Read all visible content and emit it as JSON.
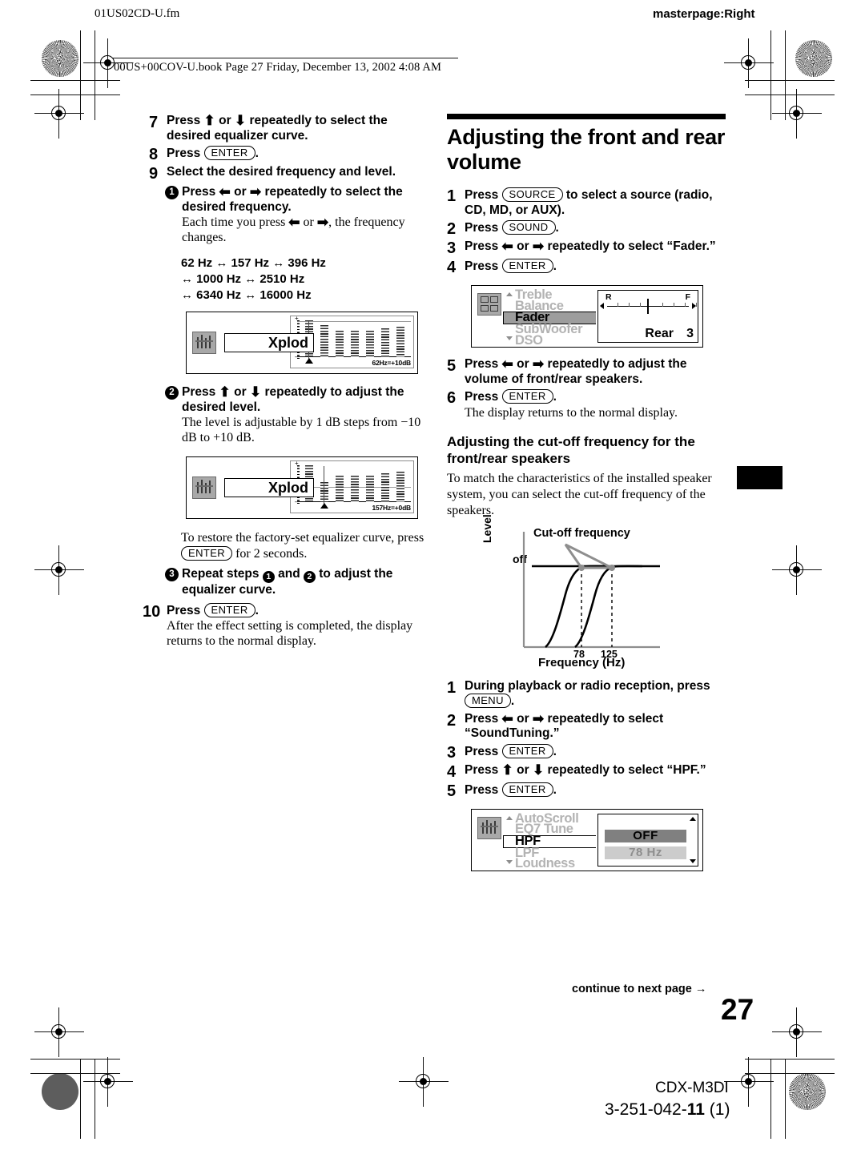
{
  "header": {
    "file_slug": "01US02CD-U.fm",
    "masterpage": "masterpage:Right",
    "book_slug": "00US+00COV-U.book  Page 27  Friday, December 13, 2002  4:08 AM"
  },
  "left_column": {
    "step7": {
      "num": "7",
      "text_a": "Press ",
      "arrow_up": "⬆",
      "text_or": " or ",
      "arrow_dn": "⬇",
      "text_b": " repeatedly to select the desired equalizer curve."
    },
    "step8": {
      "num": "8",
      "label": "Press ",
      "key": "ENTER",
      "period": "."
    },
    "step9": {
      "num": "9",
      "text": "Select the desired frequency and level."
    },
    "sub1": {
      "bullet": "1",
      "head_a": "Press ",
      "arrow_l": "⬅",
      "head_or": " or ",
      "arrow_r": "➡",
      "head_b": " repeatedly to select the desired frequency.",
      "note_a": "Each time you press ",
      "note_b": " or ",
      "note_c": ", the frequency changes.",
      "freq_line1": "62 Hz ↔ 157 Hz ↔ 396 Hz",
      "freq_line2": "↔ 1000 Hz ↔ 2510 Hz",
      "freq_line3": "↔ 6340 Hz ↔ 16000 Hz"
    },
    "lcd1": {
      "brand": "Xplod",
      "readout": "62Hz=+10dB"
    },
    "sub2": {
      "bullet": "2",
      "head_a": "Press ",
      "arrow_up": "⬆",
      "head_or": " or ",
      "arrow_dn": "⬇",
      "head_b": " repeatedly to adjust the desired level.",
      "note": "The level is adjustable by 1 dB steps from −10 dB to +10 dB."
    },
    "lcd2": {
      "brand": "Xplod",
      "readout": "157Hz=+0dB"
    },
    "restore": {
      "line_a": "To restore the factory-set equalizer curve, press ",
      "key": "ENTER",
      "line_b": " for 2 seconds."
    },
    "sub3": {
      "bullet": "3",
      "text_a": "Repeat steps ",
      "b1": "1",
      "text_and": " and ",
      "b2": "2",
      "text_b": " to adjust the equalizer curve."
    },
    "step10": {
      "num": "10",
      "label": "Press ",
      "key": "ENTER",
      "period": ".",
      "note": "After the effect setting is completed, the display returns to the normal display."
    }
  },
  "right_column": {
    "section_title": "Adjusting the front and rear volume",
    "step1": {
      "num": "1",
      "text_a": "Press ",
      "key": "SOURCE",
      "text_b": " to select a source (radio, CD, MD, or AUX)."
    },
    "step2": {
      "num": "2",
      "text_a": "Press ",
      "key": "SOUND",
      "text_b": "."
    },
    "step3": {
      "num": "3",
      "text_a": "Press ",
      "arrow_l": "⬅",
      "text_or": " or ",
      "arrow_r": "➡",
      "text_b": " repeatedly to select “Fader.”"
    },
    "step4": {
      "num": "4",
      "text_a": "Press ",
      "key": "ENTER",
      "text_b": "."
    },
    "fader_lcd": {
      "menu": [
        {
          "label": "Treble",
          "selected": false
        },
        {
          "label": "Balance",
          "selected": false
        },
        {
          "label": "Fader",
          "selected": true
        },
        {
          "label": "SubWoofer",
          "selected": false
        },
        {
          "label": "DSO",
          "selected": false
        }
      ],
      "left_mark": "R",
      "right_mark": "F",
      "value_label": "Rear",
      "value": "3"
    },
    "step5": {
      "num": "5",
      "text_a": "Press ",
      "arrow_l": "⬅",
      "text_or": " or ",
      "arrow_r": "➡",
      "text_b": " repeatedly to adjust the volume of front/rear speakers."
    },
    "step6": {
      "num": "6",
      "text_a": "Press ",
      "key": "ENTER",
      "text_b": ".",
      "note": "The display returns to the normal display."
    },
    "cutoff_head": "Adjusting the cut-off frequency for the front/rear speakers",
    "cutoff_intro": "To match the characteristics of the installed speaker system, you can select the cut-off frequency of the speakers.",
    "hpf_step1": {
      "num": "1",
      "text_a": "During playback or radio reception, press ",
      "key": "MENU",
      "text_b": "."
    },
    "hpf_step2": {
      "num": "2",
      "text_a": "Press ",
      "arrow_l": "⬅",
      "text_or": " or ",
      "arrow_r": "➡",
      "text_b": " repeatedly to select “SoundTuning.”"
    },
    "hpf_step3": {
      "num": "3",
      "text_a": "Press ",
      "key": "ENTER",
      "text_b": "."
    },
    "hpf_step4": {
      "num": "4",
      "text_a": "Press ",
      "arrow_up": "⬆",
      "text_or": " or ",
      "arrow_dn": "⬇",
      "text_b": " repeatedly to select “HPF.”"
    },
    "hpf_step5": {
      "num": "5",
      "text_a": "Press ",
      "key": "ENTER",
      "text_b": "."
    },
    "hpf_lcd": {
      "menu": [
        {
          "label": "AutoScroll",
          "selected": false
        },
        {
          "label": "EQ7 Tune",
          "selected": false
        },
        {
          "label": "HPF",
          "selected": true
        },
        {
          "label": "LPF",
          "selected": false
        },
        {
          "label": "Loudness",
          "selected": false
        }
      ],
      "option_selected": "OFF",
      "option_other": "78 Hz"
    }
  },
  "chart_data": {
    "type": "line",
    "title": "Cut-off frequency",
    "xlabel": "Frequency (Hz)",
    "ylabel": "Level",
    "off_label": "off",
    "tick_labels": [
      "78",
      "125"
    ],
    "x_ticks": [
      78,
      125
    ],
    "series": [
      {
        "name": "HPF 78 Hz",
        "description": "high-pass roll-off reaching flat level at 78 Hz"
      },
      {
        "name": "HPF 125 Hz",
        "description": "high-pass roll-off reaching flat level at 125 Hz"
      },
      {
        "name": "off",
        "description": "flat horizontal response across all frequencies"
      }
    ],
    "grid": false,
    "legend": "none"
  },
  "footer": {
    "continue": "continue to next page →",
    "page_number": "27",
    "model": "CDX-M3DI",
    "part_number_prefix": "3-251-042-",
    "part_number_bold": "11",
    "part_number_suffix": " (1)"
  }
}
